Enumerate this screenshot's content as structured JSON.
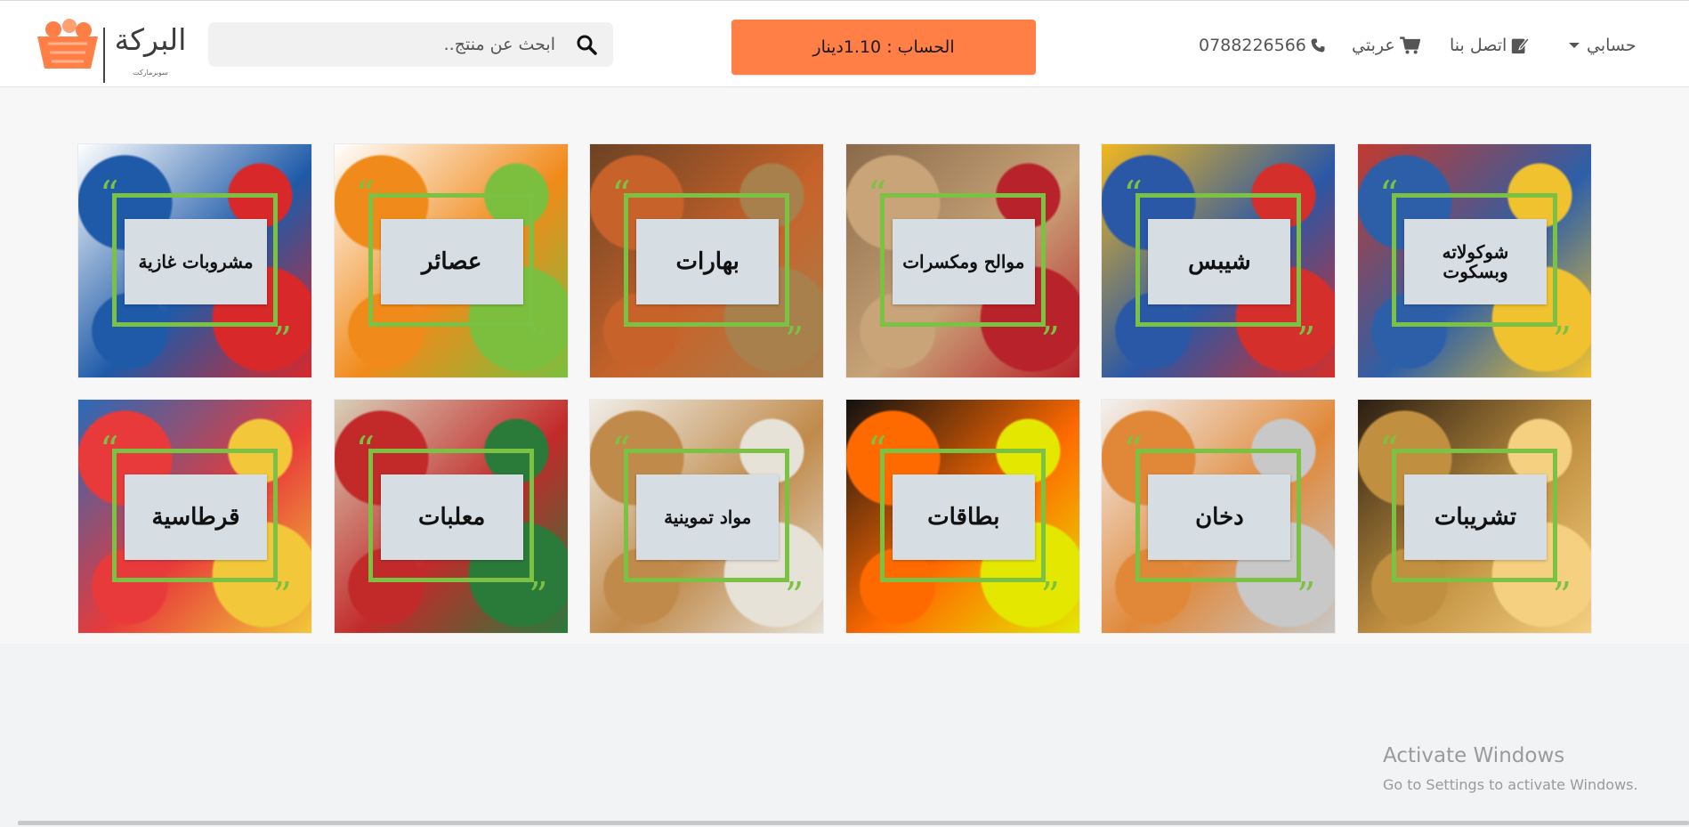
{
  "header": {
    "logo_text": "البركة",
    "logo_sub": "سوبرماركت",
    "search_placeholder": "ابحث عن منتج..",
    "balance_label": "الحساب : 1.10دينار",
    "phone": "0788226566",
    "cart_label": "عربتي",
    "contact_label": "اتصل بنا",
    "account_label": "حسابي"
  },
  "categories": [
    {
      "label": "شوكولاته وبسكوت",
      "colors": [
        "#c23a2e",
        "#2d5fa8",
        "#f0c230"
      ]
    },
    {
      "label": "شيبس",
      "colors": [
        "#f0b820",
        "#2a57a6",
        "#d42f2a"
      ]
    },
    {
      "label": "موالح ومكسرات",
      "colors": [
        "#8a6a4a",
        "#c8a478",
        "#b8222a"
      ]
    },
    {
      "label": "بهارات",
      "colors": [
        "#6b4224",
        "#c7632a",
        "#a8804c"
      ]
    },
    {
      "label": "عصائر",
      "colors": [
        "#ffffff",
        "#f08a1a",
        "#7cbf3e"
      ]
    },
    {
      "label": "مشروبات غازية",
      "colors": [
        "#ffffff",
        "#1e5aa8",
        "#d8282a"
      ]
    },
    {
      "label": "تشريبات",
      "colors": [
        "#2a1e12",
        "#c09040",
        "#f4d080"
      ]
    },
    {
      "label": "دخان",
      "colors": [
        "#f2f2f2",
        "#e08838",
        "#c8c8c8"
      ]
    },
    {
      "label": "بطاقات",
      "colors": [
        "#111111",
        "#ff6a00",
        "#e4e800"
      ]
    },
    {
      "label": "مواد تموينية",
      "colors": [
        "#f0eee8",
        "#c08a4a",
        "#e6e2d8"
      ]
    },
    {
      "label": "معلبات",
      "colors": [
        "#d8d0b8",
        "#c22a2a",
        "#2a7a3a"
      ]
    },
    {
      "label": "قرطاسية",
      "colors": [
        "#2a6ab8",
        "#e83a3a",
        "#f2c83a"
      ]
    }
  ],
  "watermark": {
    "line1": "Activate Windows",
    "line2": "Go to Settings to activate Windows."
  }
}
